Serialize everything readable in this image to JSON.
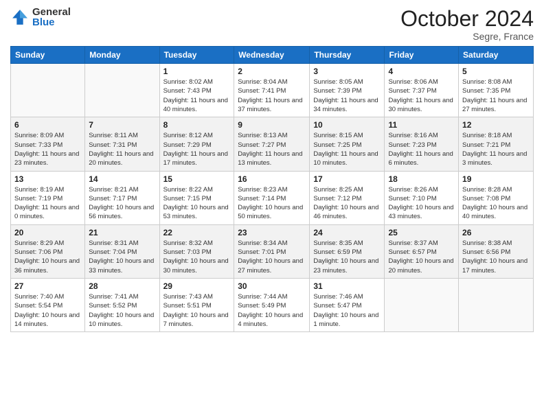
{
  "logo": {
    "general": "General",
    "blue": "Blue"
  },
  "header": {
    "month": "October 2024",
    "location": "Segre, France"
  },
  "weekdays": [
    "Sunday",
    "Monday",
    "Tuesday",
    "Wednesday",
    "Thursday",
    "Friday",
    "Saturday"
  ],
  "weeks": [
    [
      {
        "day": "",
        "info": ""
      },
      {
        "day": "",
        "info": ""
      },
      {
        "day": "1",
        "info": "Sunrise: 8:02 AM\nSunset: 7:43 PM\nDaylight: 11 hours and 40 minutes."
      },
      {
        "day": "2",
        "info": "Sunrise: 8:04 AM\nSunset: 7:41 PM\nDaylight: 11 hours and 37 minutes."
      },
      {
        "day": "3",
        "info": "Sunrise: 8:05 AM\nSunset: 7:39 PM\nDaylight: 11 hours and 34 minutes."
      },
      {
        "day": "4",
        "info": "Sunrise: 8:06 AM\nSunset: 7:37 PM\nDaylight: 11 hours and 30 minutes."
      },
      {
        "day": "5",
        "info": "Sunrise: 8:08 AM\nSunset: 7:35 PM\nDaylight: 11 hours and 27 minutes."
      }
    ],
    [
      {
        "day": "6",
        "info": "Sunrise: 8:09 AM\nSunset: 7:33 PM\nDaylight: 11 hours and 23 minutes."
      },
      {
        "day": "7",
        "info": "Sunrise: 8:11 AM\nSunset: 7:31 PM\nDaylight: 11 hours and 20 minutes."
      },
      {
        "day": "8",
        "info": "Sunrise: 8:12 AM\nSunset: 7:29 PM\nDaylight: 11 hours and 17 minutes."
      },
      {
        "day": "9",
        "info": "Sunrise: 8:13 AM\nSunset: 7:27 PM\nDaylight: 11 hours and 13 minutes."
      },
      {
        "day": "10",
        "info": "Sunrise: 8:15 AM\nSunset: 7:25 PM\nDaylight: 11 hours and 10 minutes."
      },
      {
        "day": "11",
        "info": "Sunrise: 8:16 AM\nSunset: 7:23 PM\nDaylight: 11 hours and 6 minutes."
      },
      {
        "day": "12",
        "info": "Sunrise: 8:18 AM\nSunset: 7:21 PM\nDaylight: 11 hours and 3 minutes."
      }
    ],
    [
      {
        "day": "13",
        "info": "Sunrise: 8:19 AM\nSunset: 7:19 PM\nDaylight: 11 hours and 0 minutes."
      },
      {
        "day": "14",
        "info": "Sunrise: 8:21 AM\nSunset: 7:17 PM\nDaylight: 10 hours and 56 minutes."
      },
      {
        "day": "15",
        "info": "Sunrise: 8:22 AM\nSunset: 7:15 PM\nDaylight: 10 hours and 53 minutes."
      },
      {
        "day": "16",
        "info": "Sunrise: 8:23 AM\nSunset: 7:14 PM\nDaylight: 10 hours and 50 minutes."
      },
      {
        "day": "17",
        "info": "Sunrise: 8:25 AM\nSunset: 7:12 PM\nDaylight: 10 hours and 46 minutes."
      },
      {
        "day": "18",
        "info": "Sunrise: 8:26 AM\nSunset: 7:10 PM\nDaylight: 10 hours and 43 minutes."
      },
      {
        "day": "19",
        "info": "Sunrise: 8:28 AM\nSunset: 7:08 PM\nDaylight: 10 hours and 40 minutes."
      }
    ],
    [
      {
        "day": "20",
        "info": "Sunrise: 8:29 AM\nSunset: 7:06 PM\nDaylight: 10 hours and 36 minutes."
      },
      {
        "day": "21",
        "info": "Sunrise: 8:31 AM\nSunset: 7:04 PM\nDaylight: 10 hours and 33 minutes."
      },
      {
        "day": "22",
        "info": "Sunrise: 8:32 AM\nSunset: 7:03 PM\nDaylight: 10 hours and 30 minutes."
      },
      {
        "day": "23",
        "info": "Sunrise: 8:34 AM\nSunset: 7:01 PM\nDaylight: 10 hours and 27 minutes."
      },
      {
        "day": "24",
        "info": "Sunrise: 8:35 AM\nSunset: 6:59 PM\nDaylight: 10 hours and 23 minutes."
      },
      {
        "day": "25",
        "info": "Sunrise: 8:37 AM\nSunset: 6:57 PM\nDaylight: 10 hours and 20 minutes."
      },
      {
        "day": "26",
        "info": "Sunrise: 8:38 AM\nSunset: 6:56 PM\nDaylight: 10 hours and 17 minutes."
      }
    ],
    [
      {
        "day": "27",
        "info": "Sunrise: 7:40 AM\nSunset: 5:54 PM\nDaylight: 10 hours and 14 minutes."
      },
      {
        "day": "28",
        "info": "Sunrise: 7:41 AM\nSunset: 5:52 PM\nDaylight: 10 hours and 10 minutes."
      },
      {
        "day": "29",
        "info": "Sunrise: 7:43 AM\nSunset: 5:51 PM\nDaylight: 10 hours and 7 minutes."
      },
      {
        "day": "30",
        "info": "Sunrise: 7:44 AM\nSunset: 5:49 PM\nDaylight: 10 hours and 4 minutes."
      },
      {
        "day": "31",
        "info": "Sunrise: 7:46 AM\nSunset: 5:47 PM\nDaylight: 10 hours and 1 minute."
      },
      {
        "day": "",
        "info": ""
      },
      {
        "day": "",
        "info": ""
      }
    ]
  ]
}
